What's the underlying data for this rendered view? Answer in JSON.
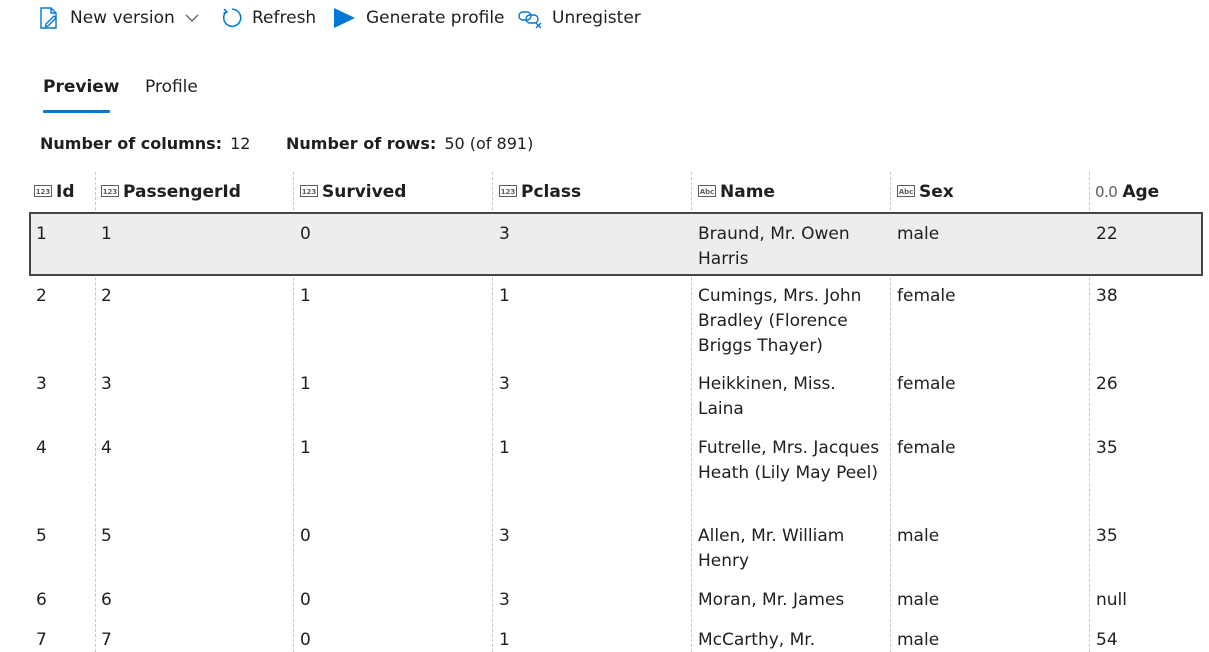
{
  "toolbar": {
    "new_version": {
      "label": "New version",
      "icon": "edit-icon"
    },
    "refresh": {
      "label": "Refresh",
      "icon": "refresh-icon"
    },
    "generate_profile": {
      "label": "Generate profile",
      "icon": "play-icon"
    },
    "unregister": {
      "label": "Unregister",
      "icon": "unlink-icon"
    }
  },
  "tabs": [
    {
      "label": "Preview",
      "active": true
    },
    {
      "label": "Profile",
      "active": false
    }
  ],
  "stats": {
    "columns_label": "Number of columns:",
    "columns_value": "12",
    "rows_label": "Number of rows:",
    "rows_value": "50 (of 891)"
  },
  "colors": {
    "accent": "#0078d4",
    "selected_row_bg": "#eeedec",
    "selected_row_border": "#444444"
  },
  "table": {
    "columns": [
      {
        "name": "Id",
        "type": "numeric",
        "type_icon": "123"
      },
      {
        "name": "PassengerId",
        "type": "numeric",
        "type_icon": "123"
      },
      {
        "name": "Survived",
        "type": "numeric",
        "type_icon": "123"
      },
      {
        "name": "Pclass",
        "type": "numeric",
        "type_icon": "123"
      },
      {
        "name": "Name",
        "type": "string",
        "type_icon": "Abc"
      },
      {
        "name": "Sex",
        "type": "string",
        "type_icon": "Abc"
      },
      {
        "name": "Age",
        "type": "decimal",
        "type_icon": "0.0"
      }
    ],
    "rows": [
      {
        "id": "1",
        "passengerid": "1",
        "survived": "0",
        "pclass": "3",
        "name": "Braund, Mr. Owen Harris",
        "sex": "male",
        "age": "22"
      },
      {
        "id": "2",
        "passengerid": "2",
        "survived": "1",
        "pclass": "1",
        "name": "Cumings, Mrs. John Bradley (Florence Briggs Thayer)",
        "sex": "female",
        "age": "38"
      },
      {
        "id": "3",
        "passengerid": "3",
        "survived": "1",
        "pclass": "3",
        "name": "Heikkinen, Miss. Laina",
        "sex": "female",
        "age": "26"
      },
      {
        "id": "4",
        "passengerid": "4",
        "survived": "1",
        "pclass": "1",
        "name": "Futrelle, Mrs. Jacques Heath (Lily May Peel)",
        "sex": "female",
        "age": "35"
      },
      {
        "id": "5",
        "passengerid": "5",
        "survived": "0",
        "pclass": "3",
        "name": "Allen, Mr. William Henry",
        "sex": "male",
        "age": "35"
      },
      {
        "id": "6",
        "passengerid": "6",
        "survived": "0",
        "pclass": "3",
        "name": "Moran, Mr. James",
        "sex": "male",
        "age": "null"
      },
      {
        "id": "7",
        "passengerid": "7",
        "survived": "0",
        "pclass": "1",
        "name": "McCarthy, Mr.",
        "sex": "male",
        "age": "54"
      }
    ]
  }
}
